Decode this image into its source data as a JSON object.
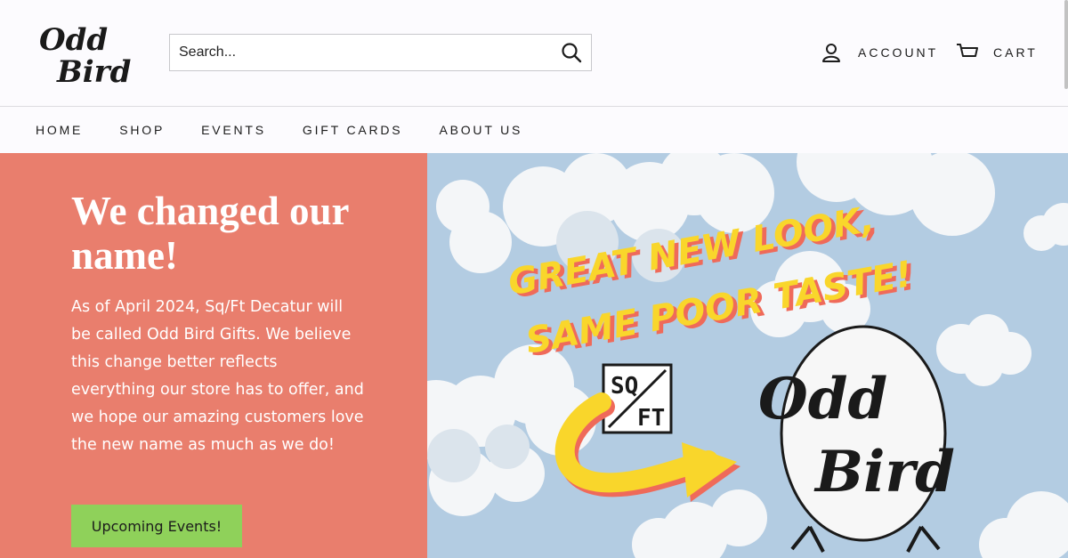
{
  "brand": {
    "logo_line1": "Odd",
    "logo_line2": "Bird"
  },
  "search": {
    "placeholder": "Search..."
  },
  "account": {
    "label": "ACCOUNT"
  },
  "cart": {
    "label": "CART"
  },
  "nav": {
    "items": [
      {
        "label": "HOME"
      },
      {
        "label": "SHOP"
      },
      {
        "label": "EVENTS"
      },
      {
        "label": "GIFT CARDS"
      },
      {
        "label": "ABOUT US"
      }
    ]
  },
  "hero": {
    "title": "We changed our name!",
    "body": "As of April 2024, Sq/Ft Decatur will be called Odd Bird Gifts. We believe this change better reflects everything our store has to offer, and we hope our amazing customers love the new name as much as we do!",
    "button_label": "Upcoming Events!",
    "background_color": "#e97e6d",
    "button_color": "#8fd15a"
  },
  "banner": {
    "tagline_line1": "GREAT NEW LOOK,",
    "tagline_line2": "SAME POOR TASTE!",
    "old_logo_line1": "SQ",
    "old_logo_line2": "FT",
    "new_logo_line1": "Odd",
    "new_logo_line2": "Bird",
    "sky_color": "#b3cce2",
    "tagline_color": "#f9d62b"
  }
}
